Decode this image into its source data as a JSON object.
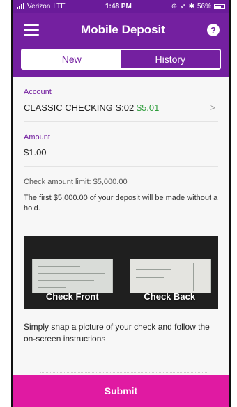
{
  "status_bar": {
    "carrier": "Verizon",
    "network": "LTE",
    "time": "1:48 PM",
    "battery": "56%"
  },
  "header": {
    "title": "Mobile Deposit",
    "help_symbol": "?"
  },
  "tabs": [
    {
      "label": "New",
      "active": true
    },
    {
      "label": "History",
      "active": false
    }
  ],
  "account": {
    "label": "Account",
    "name": "CLASSIC CHECKING S:02",
    "balance": "$5.01"
  },
  "amount": {
    "label": "Amount",
    "value": "$1.00"
  },
  "limit_note": "Check amount limit: $5,000.00",
  "hold_note": "The first $5,000.00 of your deposit will be made without a hold.",
  "checks": {
    "front_label": "Check Front",
    "back_label": "Check Back"
  },
  "instructions": "Simply snap a picture of your check and follow the on-screen instructions",
  "submit_label": "Submit",
  "colors": {
    "brand_purple": "#7420a0",
    "submit_pink": "#e01aa2",
    "balance_green": "#2e9d3b"
  }
}
